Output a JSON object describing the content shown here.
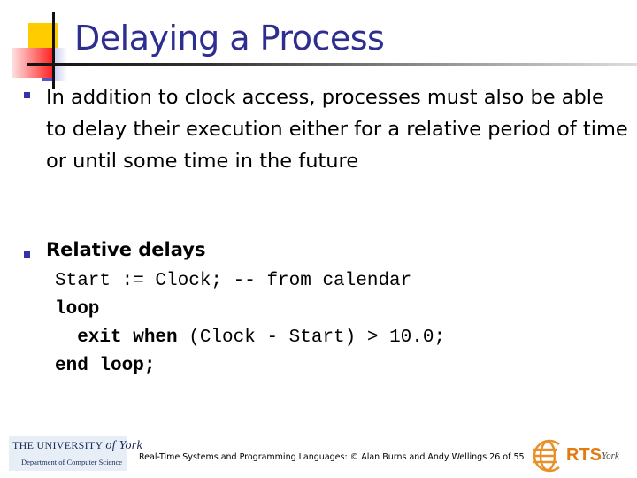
{
  "slide": {
    "title": "Delaying a Process",
    "bullets": [
      {
        "text": "In addition to clock access, processes must also be able to delay their execution either for a relative period of time or until some time in the future"
      },
      {
        "text": "Relative delays"
      }
    ],
    "code": {
      "line1": "Start := Clock; -- from calendar",
      "line2_kw": "loop",
      "line3_kw": "  exit when",
      "line3_rest": " (Clock - Start) > 10.0;",
      "line4_kw": "end loop;"
    }
  },
  "footer": {
    "text": "Real-Time Systems and Programming Languages: © Alan Burns and Andy Wellings 26 of 55",
    "university_logo": {
      "line1": "THE UNIVERSITY ",
      "line1_italic": "of York",
      "line2": "Department of Computer Science"
    },
    "rts_logo": {
      "text": "RTS",
      "suffix": "York",
      "icon": "globe-icon"
    }
  },
  "colors": {
    "title": "#2e2e8f",
    "bullet": "#3333aa",
    "rts_orange": "#e07b10"
  }
}
